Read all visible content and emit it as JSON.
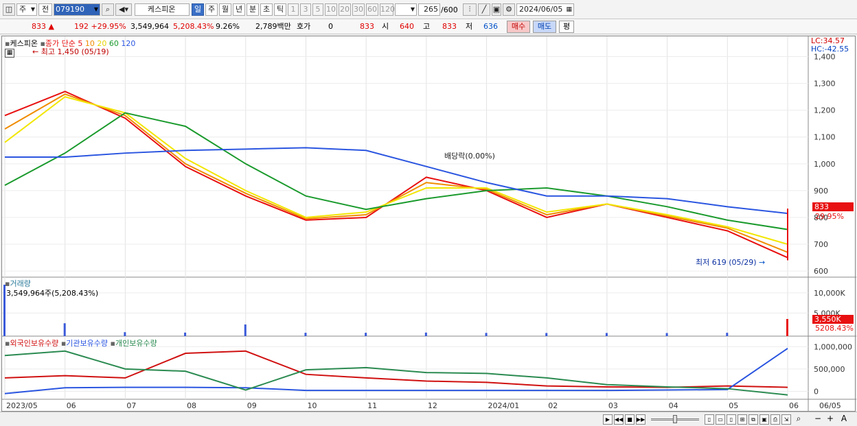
{
  "toolbar": {
    "period_sel": "주",
    "prev_label": "전",
    "code": "079190",
    "stock_name": "케스피온",
    "name_badge": "종",
    "tf_day": "일",
    "tf_week": "주",
    "tf_month": "월",
    "tf_year": "년",
    "tf_min": "분",
    "tf_sec": "초",
    "tf_tick": "틱",
    "intervals": [
      "1",
      "3",
      "5",
      "10",
      "20",
      "30",
      "60",
      "120"
    ],
    "count": "265",
    "count_total": "/600",
    "date": "2024/06/05"
  },
  "quote": {
    "price": "833",
    "change": "192",
    "change_pct": "+29.95%",
    "volume": "3,549,964",
    "volume_pct": "5,208.43%",
    "turnover": "9.26%",
    "amount": "2,789백만",
    "hoga_label": "호가",
    "hoga_val": "0",
    "hoga_price": "833",
    "open_label": "시",
    "open": "640",
    "high_label": "고",
    "high": "833",
    "low_label": "저",
    "low": "636",
    "buy_label": "매수",
    "sell_label": "매도",
    "eval_label": "평"
  },
  "price_panel": {
    "stock_label": "케스피온",
    "ma_label": "종가 단순",
    "ma_periods": [
      "5",
      "10",
      "20",
      "60",
      "120"
    ],
    "ma_colors": [
      "#e81010",
      "#f08c00",
      "#f2e600",
      "#1a9a2c",
      "#2a55e0"
    ],
    "high_note": "최고 1,450 (05/19)",
    "low_note": "최저 619 (05/29)",
    "dividend_note": "배당락(0.00%)",
    "lc": "LC:34.57",
    "hc": "HC:-42.55",
    "price_tag": "833",
    "pct_tag": "29.95%"
  },
  "volume_panel": {
    "title": "거래량",
    "value_note": "3,549,964주(5,208.43%)",
    "vol_tag": "3,550K",
    "pct_tag": "5208.43%"
  },
  "holding_panel": {
    "foreign": "외국인보유수량",
    "inst": "기관보유수량",
    "indiv": "개인보유수량"
  },
  "x_labels": [
    "2023/05",
    "06",
    "07",
    "08",
    "09",
    "10",
    "11",
    "12",
    "2024/01",
    "02",
    "03",
    "04",
    "05",
    "06",
    "06/05"
  ],
  "chart_data": [
    {
      "type": "line",
      "title": "케스피온 종가 단순 5 10 20 60 120",
      "y_ticks": [
        "1,400",
        "1,300",
        "1,200",
        "1,100",
        "1,000",
        "900",
        "800",
        "700",
        "600"
      ],
      "ylim": [
        590,
        1450
      ],
      "x": [
        "2023/05",
        "06",
        "07",
        "08",
        "09",
        "10",
        "11",
        "12",
        "2024/01",
        "02",
        "03",
        "04",
        "05",
        "06"
      ],
      "series": [
        {
          "name": "5",
          "values": [
            1180,
            1270,
            1170,
            990,
            880,
            790,
            800,
            950,
            900,
            800,
            850,
            800,
            750,
            650
          ]
        },
        {
          "name": "10",
          "values": [
            1130,
            1260,
            1180,
            1000,
            890,
            795,
            810,
            930,
            905,
            810,
            850,
            805,
            760,
            670
          ]
        },
        {
          "name": "20",
          "values": [
            1080,
            1250,
            1190,
            1020,
            900,
            800,
            820,
            910,
            910,
            820,
            850,
            810,
            765,
            700
          ]
        },
        {
          "name": "60",
          "values": [
            920,
            1040,
            1190,
            1140,
            1000,
            880,
            830,
            870,
            900,
            910,
            880,
            840,
            790,
            755
          ]
        },
        {
          "name": "120",
          "values": [
            1025,
            1025,
            1040,
            1050,
            1055,
            1060,
            1050,
            990,
            930,
            880,
            880,
            870,
            840,
            815
          ]
        }
      ],
      "last_close": 833
    },
    {
      "type": "bar",
      "title": "거래량",
      "y_ticks": [
        "10,000K",
        "5,000K"
      ],
      "ylim": [
        0,
        12000000
      ],
      "x": [
        "2023/05",
        "06",
        "07",
        "08",
        "09",
        "10",
        "11",
        "12",
        "2024/01",
        "02",
        "03",
        "04",
        "05",
        "06"
      ],
      "values": [
        12000000,
        2500000,
        300000,
        200000,
        2200000,
        150000,
        150000,
        200000,
        120000,
        100000,
        100000,
        90000,
        150000,
        3549964
      ]
    },
    {
      "type": "line",
      "title": "보유수량",
      "y_ticks": [
        "1,000,000",
        "500,000",
        "0"
      ],
      "ylim": [
        -100000,
        1050000
      ],
      "x": [
        "2023/05",
        "06",
        "07",
        "08",
        "09",
        "10",
        "11",
        "12",
        "2024/01",
        "02",
        "03",
        "04",
        "05",
        "06"
      ],
      "series": [
        {
          "name": "외국인보유수량",
          "values": [
            300000,
            350000,
            300000,
            850000,
            900000,
            380000,
            300000,
            230000,
            200000,
            120000,
            100000,
            90000,
            120000,
            90000
          ]
        },
        {
          "name": "기관보유수량",
          "values": [
            -50000,
            80000,
            90000,
            90000,
            80000,
            20000,
            20000,
            20000,
            20000,
            20000,
            20000,
            30000,
            40000,
            960000
          ]
        },
        {
          "name": "개인보유수량",
          "values": [
            800000,
            900000,
            500000,
            450000,
            30000,
            480000,
            530000,
            420000,
            400000,
            300000,
            150000,
            100000,
            60000,
            -80000
          ]
        }
      ]
    }
  ]
}
